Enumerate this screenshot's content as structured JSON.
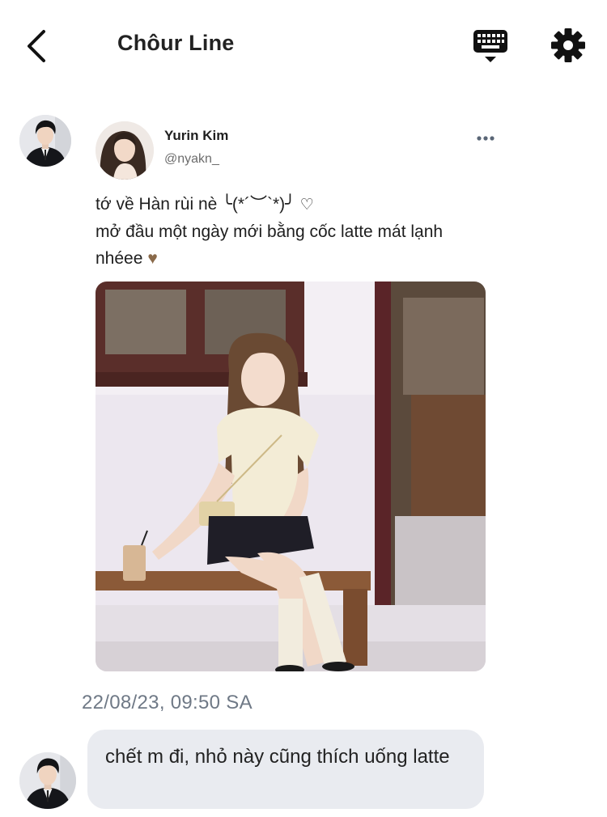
{
  "header": {
    "title": "Chôur Line",
    "back_icon": "chevron-left-icon",
    "keyboard_icon": "keyboard-icon",
    "settings_icon": "gear-icon"
  },
  "shared_post": {
    "author_name": "Yurin Kim",
    "author_handle": "@nyakn_",
    "more_icon": "ellipsis-icon",
    "text_line_1": "tớ về Hàn rùi nè ╰(*´︶`*)╯",
    "text_line_2": "mở đầu một ngày mới bằng cốc latte mát lạnh",
    "text_line_3": "nhéee",
    "heart_outline": "♡",
    "heart_brown": "♥"
  },
  "timestamp": "22/08/23, 09:50 SA",
  "reply": {
    "text": "chết m đi, nhỏ này cũng thích uống latte"
  },
  "colors": {
    "bubble_bg": "#e9ebf0",
    "timestamp": "#6f7986",
    "heart_brown": "#8a6a4a"
  }
}
